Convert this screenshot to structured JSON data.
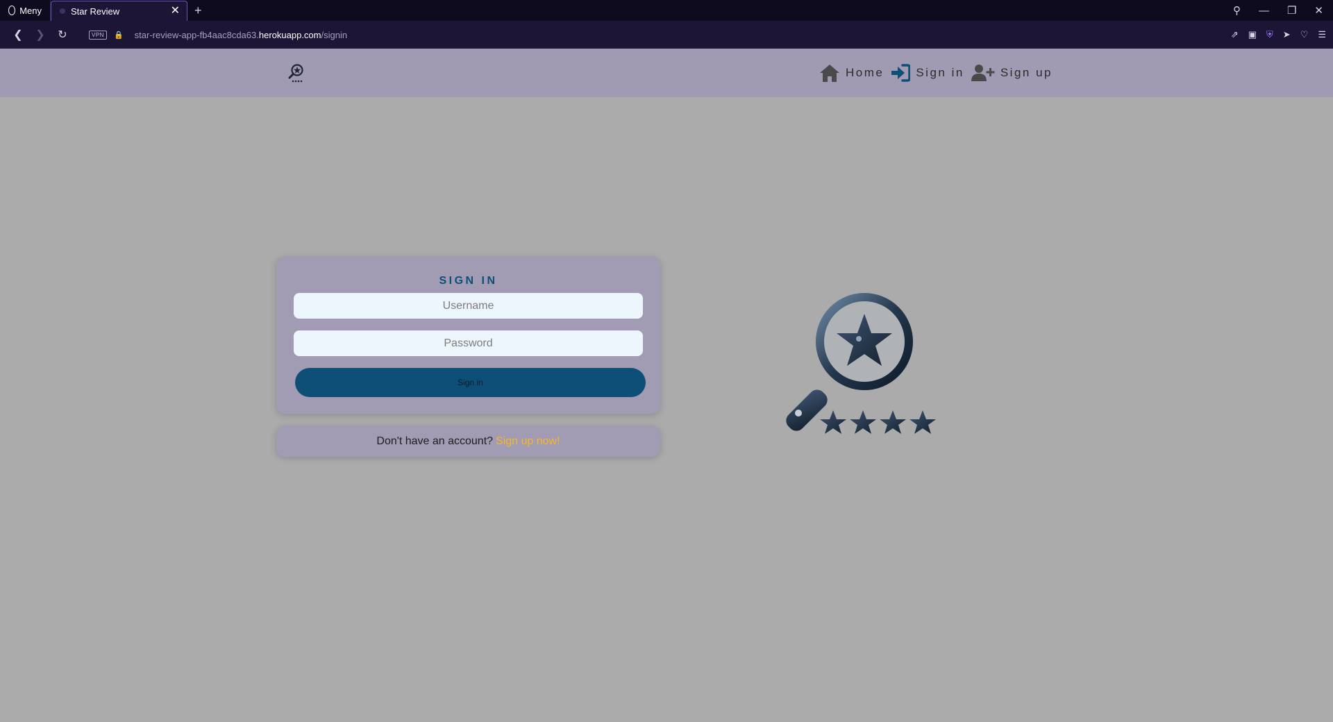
{
  "browser": {
    "menu_label": "Meny",
    "tab_title": "Star Review",
    "tab_close": "✕",
    "new_tab": "+",
    "vpn_badge": "VPN",
    "url_prefix": "star-review-app-fb4aac8cda63.",
    "url_host": "herokuapp.com",
    "url_path": "/signin"
  },
  "nav": {
    "home": "Home",
    "signin": "Sign in",
    "signup": "Sign up"
  },
  "signin": {
    "title": "SIGN IN",
    "username_placeholder": "Username",
    "password_placeholder": "Password",
    "button": "Sign in"
  },
  "signup_prompt": {
    "text": "Don't have an account?",
    "link": "Sign up now!"
  },
  "colors": {
    "accent": "#0e4f78",
    "link": "#f5b72b",
    "navbar": "#a09ab3",
    "page_bg": "#ababab"
  }
}
